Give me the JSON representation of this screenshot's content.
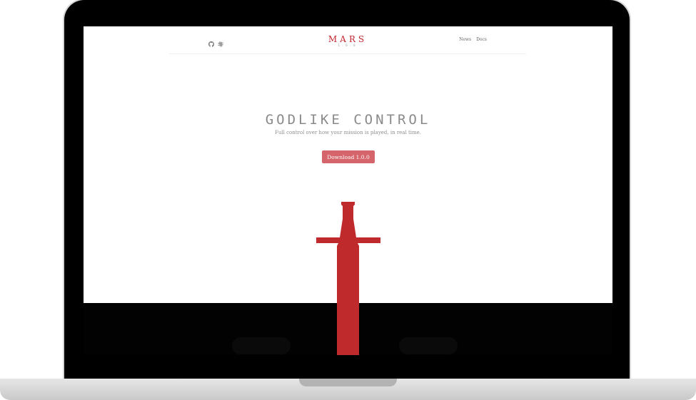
{
  "brand": {
    "name": "MARS",
    "version": "1.0.0",
    "accent_color": "#c0272d"
  },
  "nav": {
    "icons": [
      "github-icon",
      "slack-icon"
    ],
    "links": [
      "News",
      "Docs"
    ]
  },
  "hero": {
    "title": "GODLIKE CONTROL",
    "subtitle": "Full control over how your mission is played, in real time.",
    "download_label": "Download 1.0.0",
    "button_color": "#d5646b"
  },
  "illustration": {
    "icon": "sword-icon",
    "color": "#bf2a2d"
  }
}
